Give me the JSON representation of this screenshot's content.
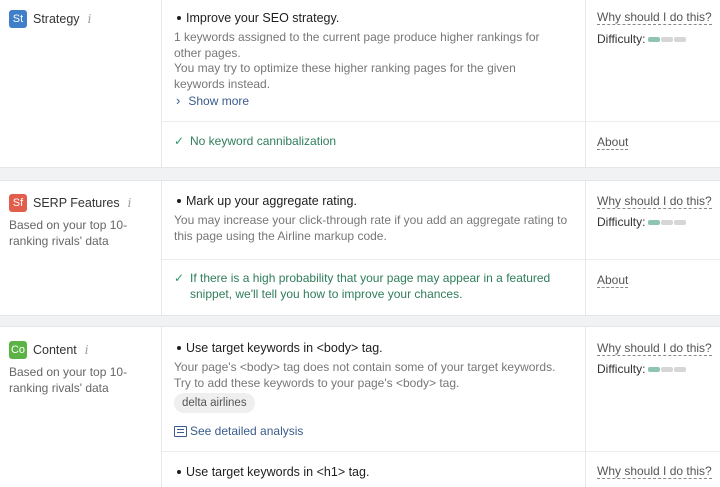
{
  "colors": {
    "strategy_badge": "#3f7fc9",
    "serp_badge": "#e25d4c",
    "content_badge": "#5bb346",
    "difficulty_filled": "#8fc4b3",
    "difficulty_empty": "#d6d6d6",
    "link": "#3a5b8c",
    "check": "#2f7d5b"
  },
  "sections": {
    "strategy": {
      "badge": "St",
      "title": "Strategy",
      "info_icon": "i",
      "rec1": {
        "title": "Improve your SEO strategy.",
        "desc1": "1 keywords assigned to the current page produce higher rankings for other pages.",
        "desc2": "You may try to optimize these higher ranking pages for the given keywords instead.",
        "show_more": "Show more",
        "why": "Why should I do this?",
        "difficulty_label": "Difficulty:",
        "difficulty_level": 1,
        "difficulty_max": 3
      },
      "check": {
        "text": "No keyword cannibalization",
        "about": "About"
      }
    },
    "serp": {
      "badge": "Sf",
      "title": "SERP Features",
      "info_icon": "i",
      "subtitle": "Based on your top 10-ranking rivals' data",
      "rec1": {
        "title": "Mark up your aggregate rating.",
        "desc": "You may increase your click-through rate if you add an aggregate rating to this page using the Airline markup code.",
        "why": "Why should I do this?",
        "difficulty_label": "Difficulty:",
        "difficulty_level": 1,
        "difficulty_max": 3
      },
      "check": {
        "text": "If there is a high probability that your page may appear in a featured snippet, we'll tell you how to improve your chances.",
        "about": "About"
      }
    },
    "content": {
      "badge": "Co",
      "title": "Content",
      "info_icon": "i",
      "subtitle": "Based on your top 10-ranking rivals' data",
      "rec1": {
        "title": "Use target keywords in <body> tag.",
        "desc1": "Your page's <body> tag does not contain some of your target keywords.",
        "desc2": "Try to add these keywords to your page's <body> tag.",
        "chip": "delta airlines",
        "link": "See detailed analysis",
        "why": "Why should I do this?",
        "difficulty_label": "Difficulty:",
        "difficulty_level": 1,
        "difficulty_max": 3
      },
      "rec2": {
        "title": "Use target keywords in <h1> tag.",
        "why": "Why should I do this?"
      }
    }
  }
}
